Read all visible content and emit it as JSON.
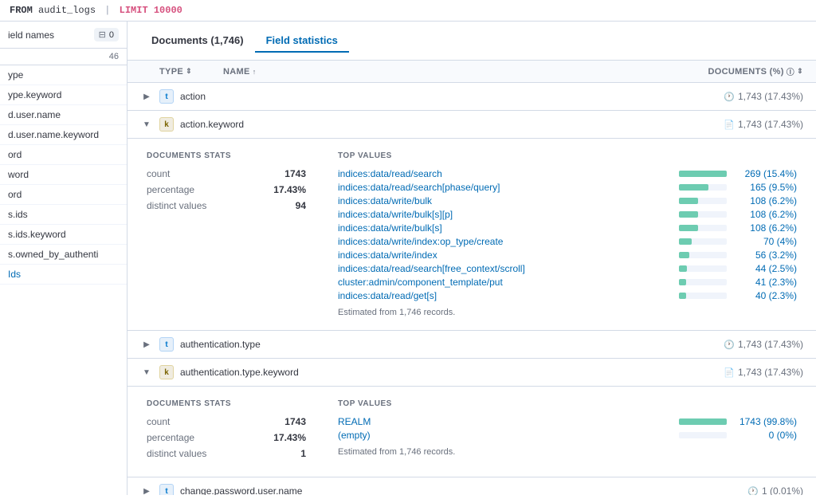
{
  "topbar": {
    "query": "FROM audit_logs | LIMIT 10000",
    "from_keyword": "FROM",
    "table_name": "audit_logs",
    "pipe": "|",
    "limit_keyword": "LIMIT",
    "limit_value": "10000"
  },
  "sidebar": {
    "header_label": "ield names",
    "filter_count": "0",
    "result_count": "46",
    "fields": [
      {
        "name": "ype",
        "active": false
      },
      {
        "name": "ype.keyword",
        "active": false
      },
      {
        "name": "d.user.name",
        "active": false
      },
      {
        "name": "d.user.name.keyword",
        "active": false
      },
      {
        "name": "ord",
        "active": false
      },
      {
        "name": "word",
        "active": false
      },
      {
        "name": "ord",
        "active": false
      },
      {
        "name": "s.ids",
        "active": false
      },
      {
        "name": "s.ids.keyword",
        "active": false
      },
      {
        "name": "s.owned_by_authenti",
        "active": false
      },
      {
        "name": "Ids",
        "active": true
      }
    ]
  },
  "content": {
    "tab_documents": "Documents (1,746)",
    "tab_field_statistics": "Field statistics",
    "col_type": "Type",
    "col_name": "Name",
    "col_docs": "Documents (%)",
    "fields": [
      {
        "id": "action",
        "type": "t",
        "name": "action",
        "expanded": false,
        "doc_count": "1,743 (17.43%)",
        "doc_icon": "clock"
      },
      {
        "id": "action_keyword",
        "type": "k",
        "name": "action.keyword",
        "expanded": true,
        "doc_count": "1,743 (17.43%)",
        "doc_icon": "file",
        "stats": {
          "count": "1743",
          "percentage": "17.43%",
          "distinct_values": "94"
        },
        "top_values": [
          {
            "name": "indices:data/read/search",
            "count": "269 (15.4%)",
            "pct": 100
          },
          {
            "name": "indices:data/read/search[phase/query]",
            "count": "165 (9.5%)",
            "pct": 61
          },
          {
            "name": "indices:data/write/bulk",
            "count": "108 (6.2%)",
            "pct": 40
          },
          {
            "name": "indices:data/write/bulk[s][p]",
            "count": "108 (6.2%)",
            "pct": 40
          },
          {
            "name": "indices:data/write/bulk[s]",
            "count": "108 (6.2%)",
            "pct": 40
          },
          {
            "name": "indices:data/write/index:op_type/create",
            "count": "70 (4%)",
            "pct": 26
          },
          {
            "name": "indices:data/write/index",
            "count": "56 (3.2%)",
            "pct": 21
          },
          {
            "name": "indices:data/read/search[free_context/scroll]",
            "count": "44 (2.5%)",
            "pct": 16
          },
          {
            "name": "cluster:admin/component_template/put",
            "count": "41 (2.3%)",
            "pct": 15
          },
          {
            "name": "indices:data/read/get[s]",
            "count": "40 (2.3%)",
            "pct": 15
          }
        ],
        "estimated": "Estimated from 1,746 records."
      },
      {
        "id": "authentication_type",
        "type": "t",
        "name": "authentication.type",
        "expanded": false,
        "doc_count": "1,743 (17.43%)",
        "doc_icon": "clock"
      },
      {
        "id": "authentication_type_keyword",
        "type": "k",
        "name": "authentication.type.keyword",
        "expanded": true,
        "doc_count": "1,743 (17.43%)",
        "doc_icon": "file",
        "stats": {
          "count": "1743",
          "percentage": "17.43%",
          "distinct_values": "1"
        },
        "top_values": [
          {
            "name": "REALM",
            "count": "1743 (99.8%)",
            "pct": 100
          },
          {
            "name": "(empty)",
            "count": "0 (0%)",
            "pct": 0
          }
        ],
        "estimated": "Estimated from 1,746 records."
      },
      {
        "id": "change_password_user_name",
        "type": "t",
        "name": "change.password.user.name",
        "expanded": false,
        "doc_count": "1 (0.01%)",
        "doc_icon": "clock"
      }
    ],
    "labels": {
      "documents_stats": "DOCUMENTS STATS",
      "top_values": "TOP VALUES",
      "count_label": "count",
      "percentage_label": "percentage",
      "distinct_label": "distinct values"
    }
  }
}
